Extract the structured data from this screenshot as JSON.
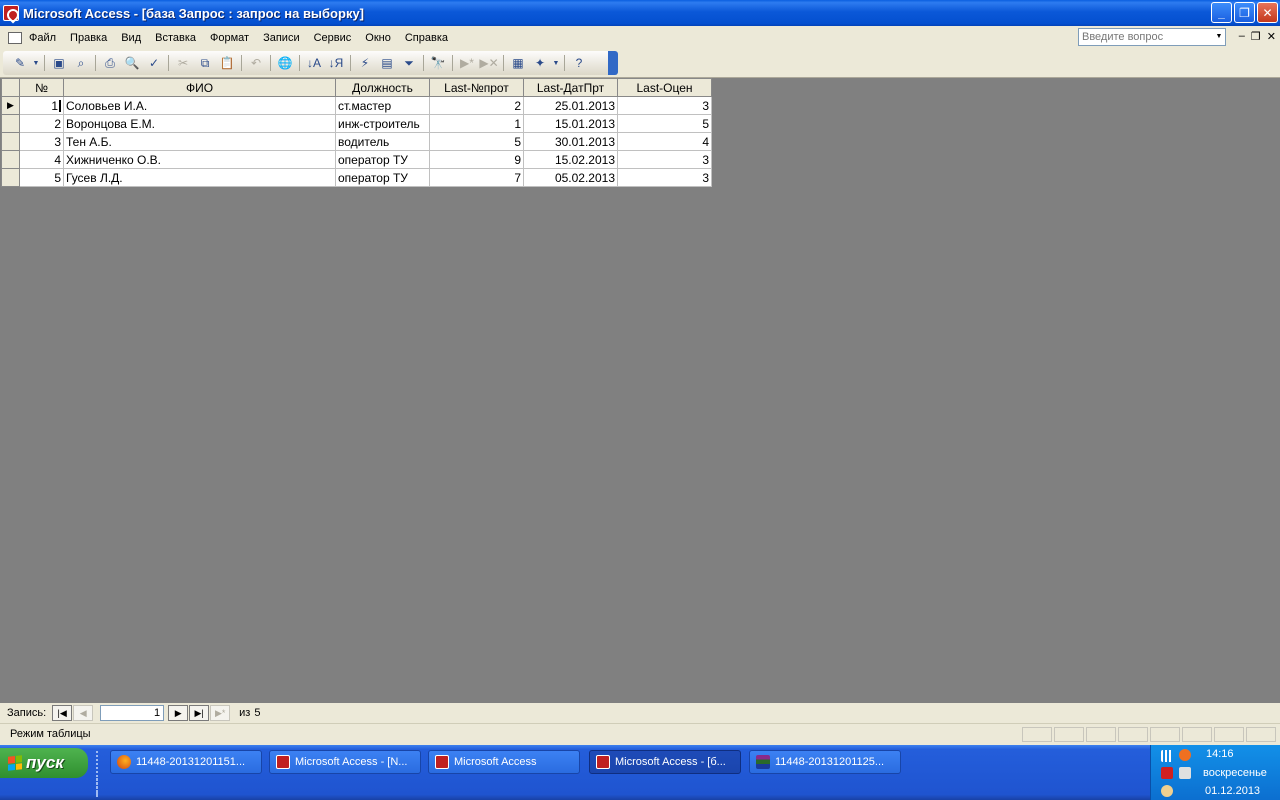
{
  "window": {
    "title": "Microsoft Access - [база Запрос : запрос на выборку]",
    "min_label": "_",
    "max_label": "❐",
    "close_label": "✕"
  },
  "menu": {
    "items": [
      "Файл",
      "Правка",
      "Вид",
      "Вставка",
      "Формат",
      "Записи",
      "Сервис",
      "Окно",
      "Справка"
    ],
    "ask_placeholder": "Введите вопрос",
    "mdi_min": "–",
    "mdi_restore": "❐",
    "mdi_close": "✕"
  },
  "datasheet": {
    "columns": [
      "№",
      "ФИО",
      "Должность",
      "Last-№прот",
      "Last-ДатПрт",
      "Last-Оцен"
    ],
    "rows": [
      {
        "n": "1",
        "fio": "Соловьев И.А.",
        "dolzh": "ст.мастер",
        "prot": "2",
        "date": "25.01.2013",
        "ocen": "3"
      },
      {
        "n": "2",
        "fio": "Воронцова Е.М.",
        "dolzh": "инж-строитель",
        "prot": "1",
        "date": "15.01.2013",
        "ocen": "5"
      },
      {
        "n": "3",
        "fio": "Тен А.Б.",
        "dolzh": "водитель",
        "prot": "5",
        "date": "30.01.2013",
        "ocen": "4"
      },
      {
        "n": "4",
        "fio": "Хижниченко О.В.",
        "dolzh": "оператор ТУ",
        "prot": "9",
        "date": "15.02.2013",
        "ocen": "3"
      },
      {
        "n": "5",
        "fio": "Гусев Л.Д.",
        "dolzh": "оператор ТУ",
        "prot": "7",
        "date": "05.02.2013",
        "ocen": "3"
      }
    ]
  },
  "record_nav": {
    "label": "Запись:",
    "current": "1",
    "of_text": "из",
    "total": "5"
  },
  "status": {
    "mode": "Режим таблицы"
  },
  "taskbar": {
    "start": "пуск",
    "tasks": [
      {
        "label": "11448-20131201151...",
        "icon": "firefox-icon"
      },
      {
        "label": "Microsoft Access - [N...",
        "icon": "access-icon"
      },
      {
        "label": "Microsoft Access",
        "icon": "access-icon"
      },
      {
        "label": "Microsoft Access - [б...",
        "icon": "access-icon"
      },
      {
        "label": "11448-20131201125...",
        "icon": "winrar-icon"
      }
    ],
    "time": "14:16",
    "day": "воскресенье",
    "date": "01.12.2013"
  }
}
